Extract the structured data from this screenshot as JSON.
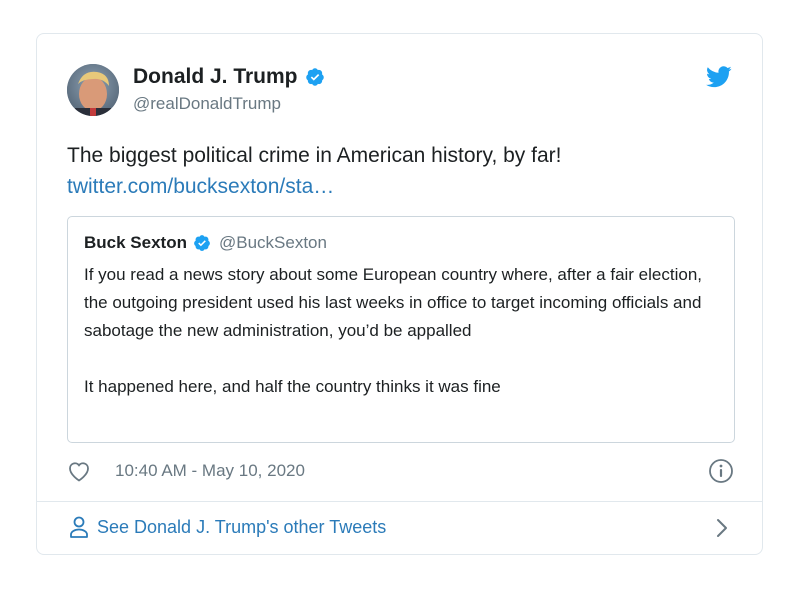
{
  "author": {
    "name": "Donald J. Trump",
    "handle": "@realDonaldTrump"
  },
  "tweet": {
    "text": "The biggest political crime in American history, by far!",
    "link": "twitter.com/bucksexton/sta…"
  },
  "quote": {
    "name": "Buck Sexton",
    "handle": "@BuckSexton",
    "paragraph_1": "If you read a news story about some European country where, after a fair election, the outgoing president used his last weeks in office to target incoming officials and sabotage the new administration, you’d be appalled",
    "paragraph_2": "It happened here, and half the country thinks it was fine"
  },
  "meta": {
    "timestamp": "10:40 AM - May 10, 2020"
  },
  "footer": {
    "label": "See Donald J. Trump's other Tweets"
  },
  "icons": {
    "verified": "verified-badge-icon",
    "twitter": "twitter-bird-icon",
    "like": "heart-icon",
    "info": "info-icon",
    "person": "person-icon",
    "chevron": "chevron-right-icon"
  },
  "colors": {
    "accent": "#1da1f2",
    "link": "#2b7bb9",
    "muted": "#697882",
    "text": "#1c2022",
    "border": "#e1e8ed"
  }
}
